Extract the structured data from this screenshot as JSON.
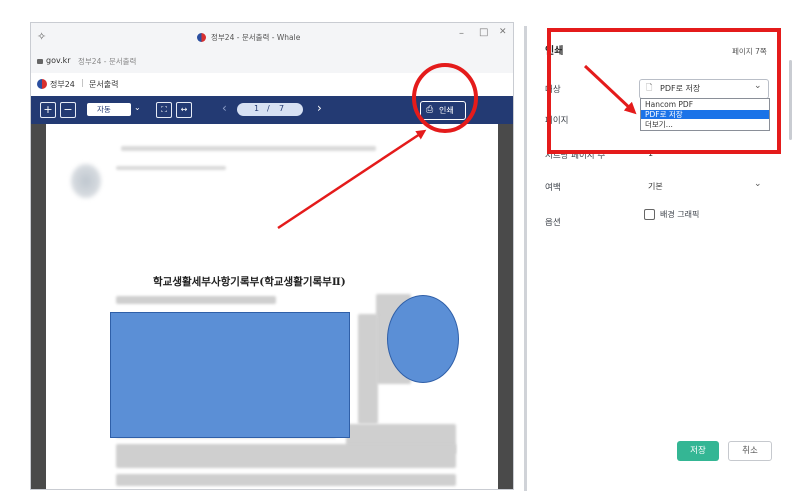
{
  "window": {
    "pin_icon": "pin-icon",
    "title": "정부24 - 문서출력 - Whale",
    "controls": [
      "–",
      "□",
      "✕"
    ]
  },
  "address": {
    "domain": "gov.kr",
    "page": "정부24 - 문서출력"
  },
  "brand": {
    "name": "정부24",
    "separator": "|",
    "section": "문서출력"
  },
  "toolbar": {
    "zoom_mode": "자동",
    "page_current": "1",
    "page_total": "7",
    "print_label": "인쇄"
  },
  "document": {
    "title": "학교생활세부사항기록부(학교생활기록부Ⅱ)"
  },
  "print_dialog": {
    "title": "인쇄",
    "page_count": "페이지 7쪽",
    "destination": {
      "label": "대상",
      "value": "PDF로 저장",
      "options": [
        "Hancom PDF",
        "PDF로 저장",
        "더보기..."
      ],
      "selected_index": 1
    },
    "pages": {
      "label": "페이지"
    },
    "pages_per_sheet": {
      "label": "시트당 페이지 수",
      "value": "1"
    },
    "margins": {
      "label": "여백",
      "value": "기본"
    },
    "options": {
      "label": "옵션",
      "checkbox_label": "배경 그래픽",
      "checked": false
    },
    "save_button": "저장",
    "cancel_button": "취소"
  },
  "colors": {
    "annotation_red": "#e41b1b",
    "toolbar_navy": "#233a73",
    "save_green": "#34b694",
    "highlight_blue": "#1a73e8",
    "redaction_blue": "#5b8fd6"
  }
}
